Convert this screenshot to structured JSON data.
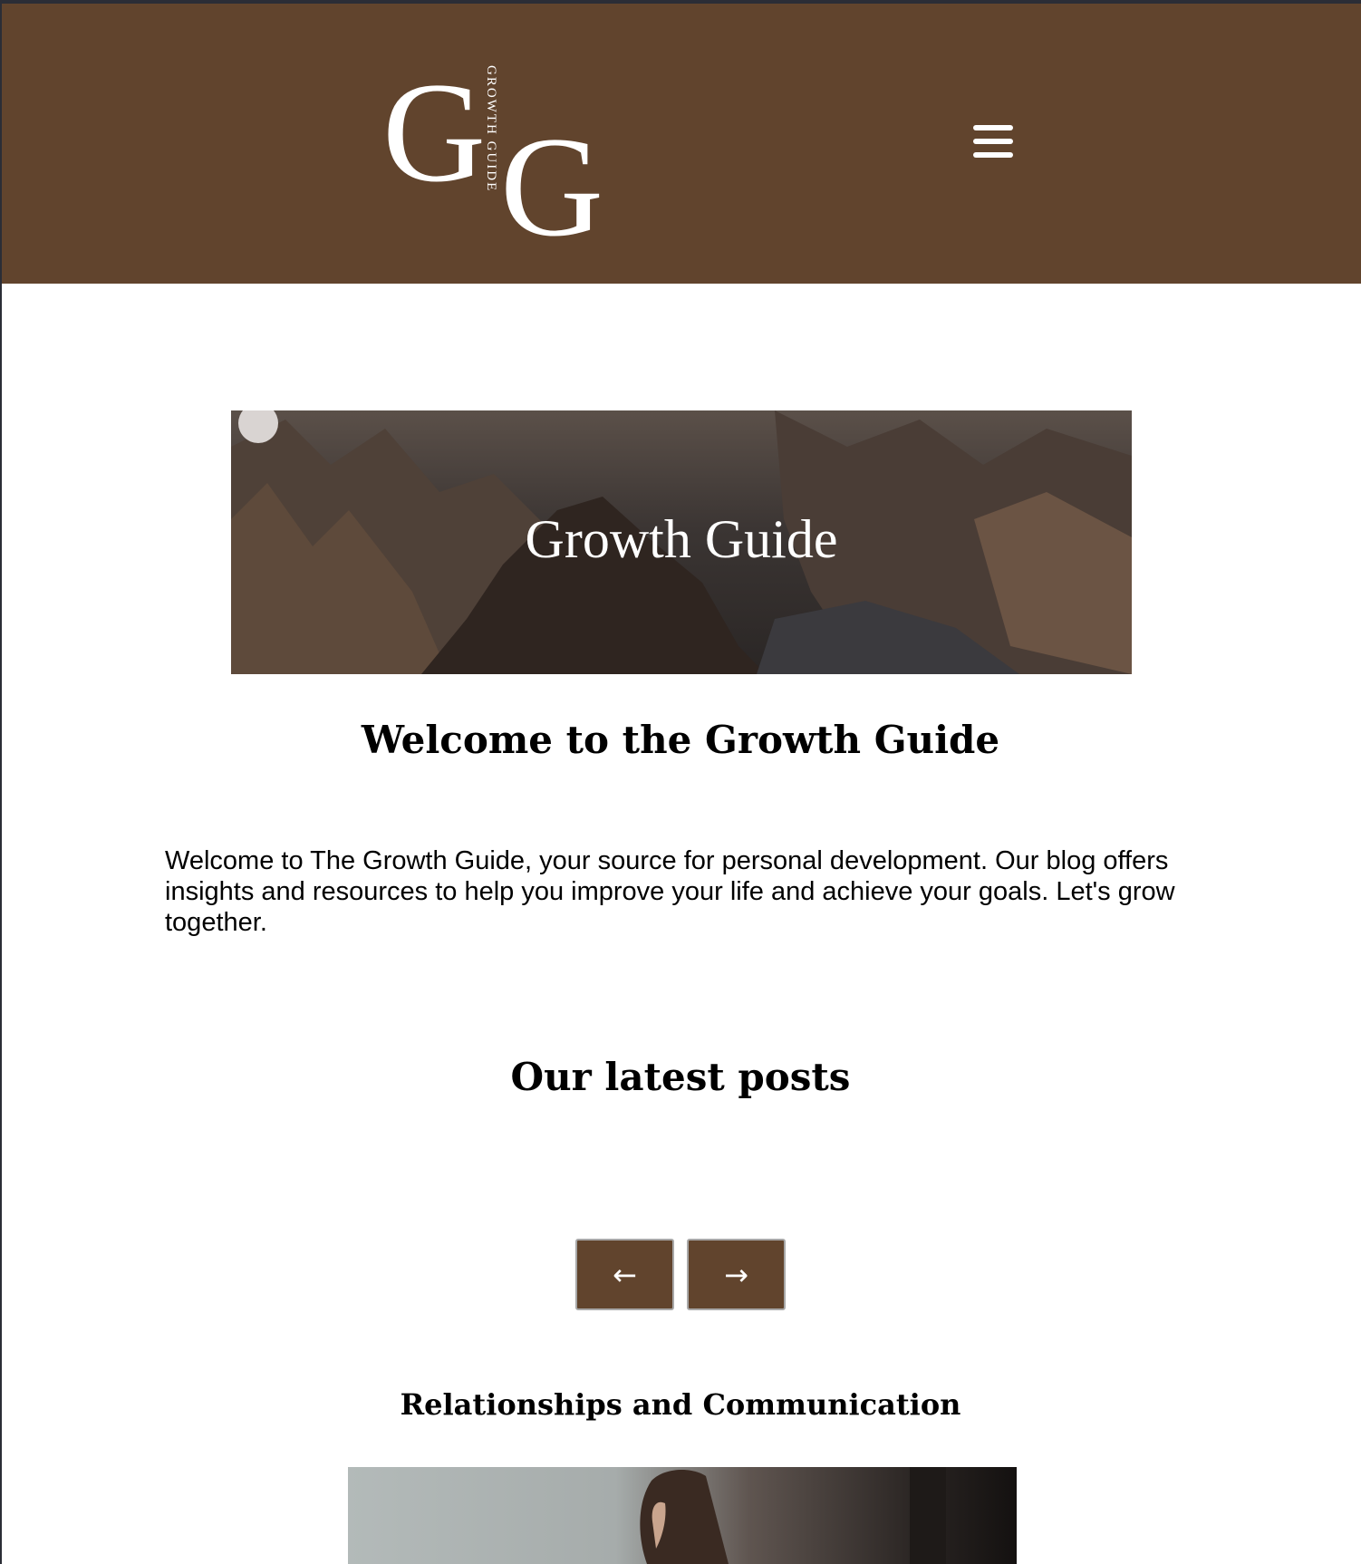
{
  "header": {
    "logo_monogram_first": "G",
    "logo_monogram_second": "G",
    "logo_vertical_text": "GROWTH GUIDE",
    "menu_icon": "hamburger-menu-icon",
    "background_color": "#61442d"
  },
  "hero": {
    "title": "Growth Guide"
  },
  "welcome": {
    "title": "Welcome to the Growth Guide",
    "body": "Welcome to The Growth Guide, your source for personal development. Our blog offers insights and resources to help you improve your life and achieve your goals. Let's grow together."
  },
  "latest": {
    "title": "Our latest posts",
    "prev_arrow": "←",
    "next_arrow": "→",
    "prev_icon": "arrow-left-icon",
    "next_icon": "arrow-right-icon",
    "posts": [
      {
        "title": "Relationships and Communication"
      }
    ]
  }
}
